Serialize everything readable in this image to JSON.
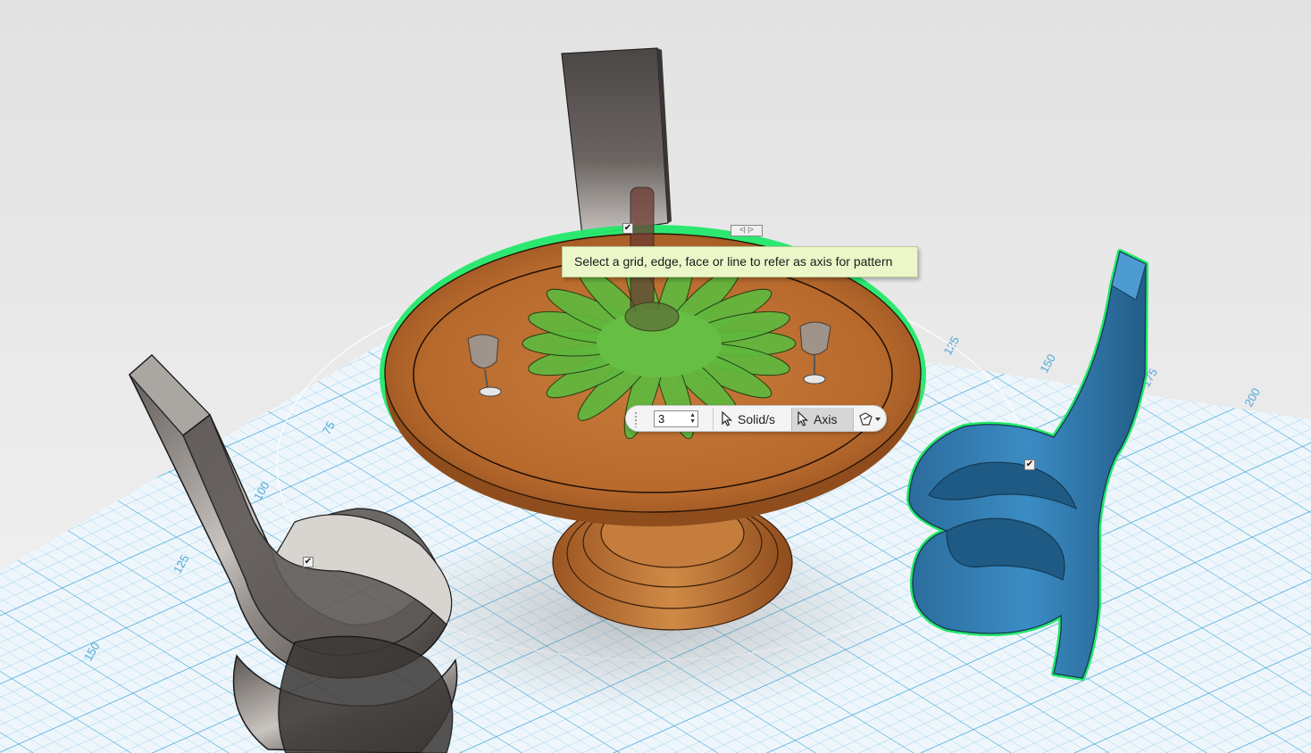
{
  "tooltip": {
    "text": "Select a grid, edge, face or line to refer as axis for pattern"
  },
  "pattern_toolbar": {
    "count_value": "3",
    "solid_label": "Solid/s",
    "axis_label": "Axis",
    "axis_selected": true
  },
  "grid": {
    "labels": [
      "75",
      "100",
      "125",
      "150",
      "125",
      "150",
      "175",
      "200"
    ]
  },
  "colors": {
    "background": "#e9e9e9",
    "grid_line": "#5bb5e0",
    "selection_highlight": "#22e86a",
    "blue_chair": "#2f7cb0",
    "table_wood": "#b8682b",
    "centerpiece_green": "#58b438"
  },
  "icons": {
    "select_cursor": "cursor-arrow-icon",
    "snap": "snap-dropdown-icon",
    "check": "check-icon"
  }
}
